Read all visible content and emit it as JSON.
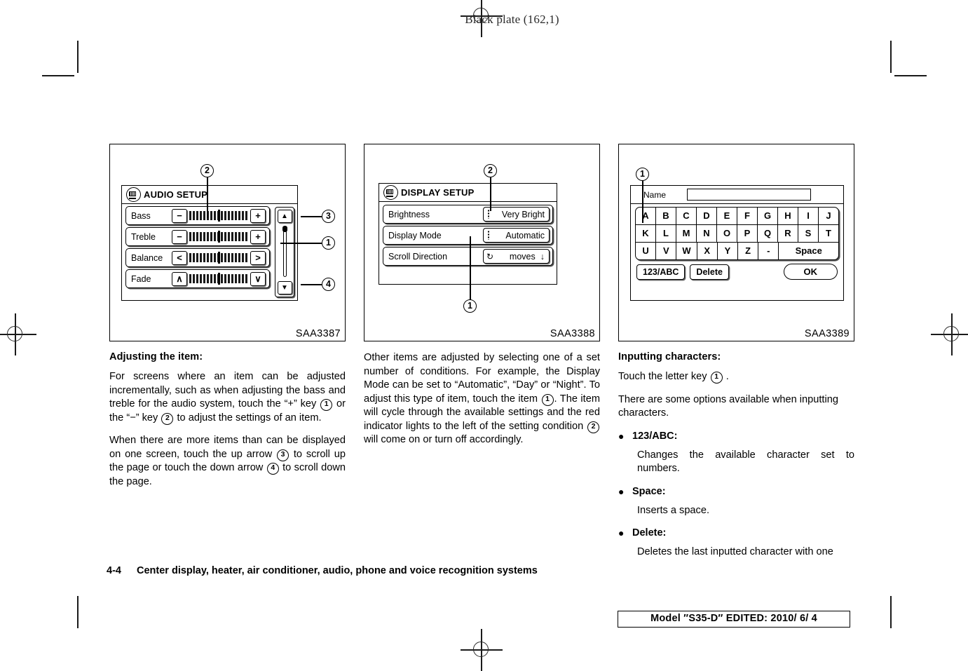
{
  "header": {
    "black_plate": "Black plate (162,1)"
  },
  "figures": {
    "audio": {
      "id": "SAA3387",
      "screen_title": "AUDIO SETUP",
      "icon": "display-icon",
      "callouts": [
        "2",
        "3",
        "1",
        "4"
      ],
      "rows": [
        {
          "label": "Bass",
          "minus": "−",
          "plus": "+"
        },
        {
          "label": "Treble",
          "minus": "−",
          "plus": "+"
        },
        {
          "label": "Balance",
          "minus": "<",
          "plus": ">"
        },
        {
          "label": "Fade",
          "minus": "∧",
          "plus": "∨"
        }
      ],
      "scroll_up": "▲",
      "scroll_down": "▼"
    },
    "display": {
      "id": "SAA3388",
      "screen_title": "DISPLAY SETUP",
      "icon": "display-icon",
      "callouts": [
        "2",
        "1"
      ],
      "rows": [
        {
          "label": "Brightness",
          "value": "Very Bright",
          "indicator": "dots"
        },
        {
          "label": "Display Mode",
          "value": "Automatic",
          "indicator": "dots"
        },
        {
          "label": "Scroll Direction",
          "value": "moves",
          "indicator": "rotate",
          "suffix": "↓"
        }
      ]
    },
    "keyboard": {
      "id": "SAA3389",
      "callouts": [
        "1"
      ],
      "name_label": "Name",
      "name_value": "",
      "keys_row1": [
        "A",
        "B",
        "C",
        "D",
        "E",
        "F",
        "G",
        "H",
        "I",
        "J"
      ],
      "keys_row2": [
        "K",
        "L",
        "M",
        "N",
        "O",
        "P",
        "Q",
        "R",
        "S",
        "T"
      ],
      "keys_row3": [
        "U",
        "V",
        "W",
        "X",
        "Y",
        "Z",
        "-"
      ],
      "space_key": "Space",
      "mode_button": "123/ABC",
      "delete_button": "Delete",
      "ok_button": "OK"
    }
  },
  "columns": {
    "one": {
      "heading": "Adjusting the item:",
      "para1_a": "For screens where an item can be adjusted incrementally, such as when adjusting the bass and treble for the audio system, touch the “+” key",
      "para1_n1": "1",
      "para1_b": "or the “−” key",
      "para1_n2": "2",
      "para1_c": "to adjust the settings of an item.",
      "para2_a": "When there are more items than can be displayed on one screen, touch the up arrow",
      "para2_n1": "3",
      "para2_b": "to scroll up the page or touch the down arrow",
      "para2_n2": "4",
      "para2_c": "to scroll down the page."
    },
    "two": {
      "para1_a": "Other items are adjusted by selecting one of a set number of conditions. For example, the Display Mode can be set to “Automatic”, “Day” or “Night”. To adjust this type of item, touch the item",
      "para1_n1": "1",
      "para1_b": ". The item will cycle through the available settings and the red indicator lights to the left of the setting condition",
      "para1_n2": "2",
      "para1_c": "will come on or turn off accordingly."
    },
    "three": {
      "heading": "Inputting characters:",
      "para1_a": "Touch the letter key",
      "para1_n1": "1",
      "para1_b": ".",
      "para2": "There are some options available when inputting characters.",
      "bullets": [
        {
          "term": "123/ABC:",
          "def": "Changes the available character set to numbers."
        },
        {
          "term": "Space:",
          "def": "Inserts a space."
        },
        {
          "term": "Delete:",
          "def": "Deletes the last inputted character with one"
        }
      ]
    }
  },
  "footer": {
    "page_number": "4-4",
    "chapter": "Center display, heater, air conditioner, audio, phone and voice recognition systems",
    "model_line": "Model ″S35-D″  EDITED:  2010/ 6/ 4"
  }
}
